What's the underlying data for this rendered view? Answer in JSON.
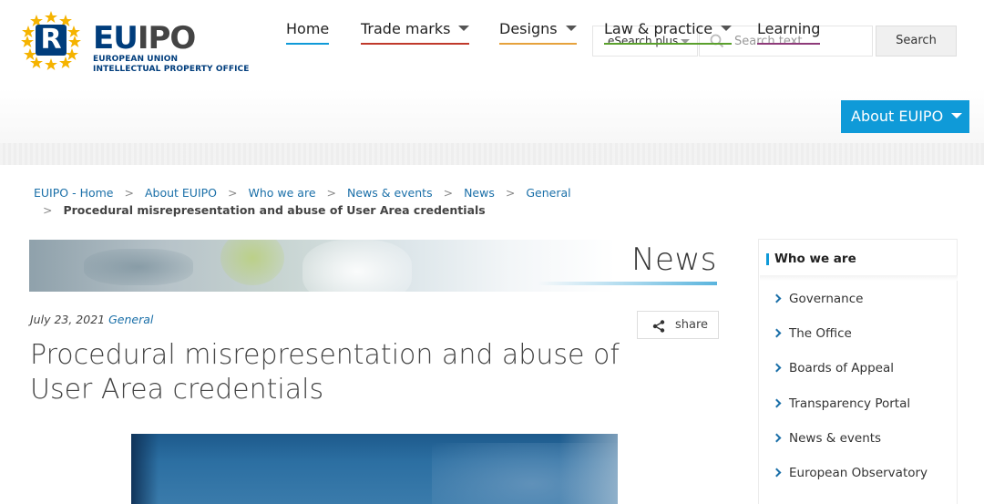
{
  "logo": {
    "mark_letter": "R",
    "word_eu": "EU",
    "word_ipo": "IPO",
    "sub_line1": "EUROPEAN UNION",
    "sub_line2": "INTELLECTUAL PROPERTY OFFICE"
  },
  "search": {
    "scope_label": "eSearch plus",
    "placeholder": "Search text",
    "button_label": "Search"
  },
  "nav": {
    "items": [
      {
        "label": "Home",
        "color": "#0f9ad8"
      },
      {
        "label": "Trade marks",
        "color": "#c0392b"
      },
      {
        "label": "Designs",
        "color": "#e6a23c"
      },
      {
        "label": "Law & practice",
        "color": "#5aa02c"
      },
      {
        "label": "Learning",
        "color": "#8e3a7a"
      }
    ],
    "active": {
      "label": "About EUIPO",
      "color": "#0f9ad8"
    }
  },
  "breadcrumb": {
    "items": [
      "EUIPO - Home",
      "About EUIPO",
      "Who we are",
      "News & events",
      "News",
      "General"
    ],
    "separator": ">",
    "current": "Procedural misrepresentation and abuse of User Area credentials"
  },
  "banner": {
    "title": "News"
  },
  "article": {
    "date": "July 23, 2021",
    "category": "General",
    "share_label": "share",
    "title": "Procedural misrepresentation and abuse of User Area credentials"
  },
  "sidebar": {
    "heading": "Who we are",
    "items": [
      "Governance",
      "The Office",
      "Boards of Appeal",
      "Transparency Portal",
      "News & events",
      "European Observatory"
    ]
  }
}
